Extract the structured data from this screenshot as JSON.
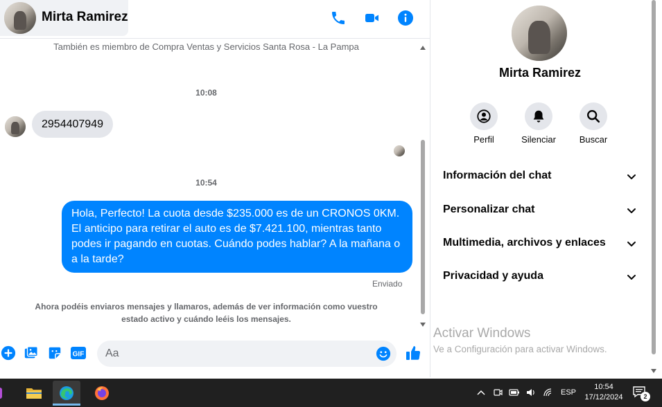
{
  "chat": {
    "contact_name": "Mirta Ramirez",
    "group_notice": "También es miembro de Compra Ventas y Servicios Santa Rosa - La Pampa",
    "time1": "10:08",
    "incoming_message": "2954407949",
    "time2": "10:54",
    "outgoing_message": "Hola, Perfecto! La cuota desde $235.000 es de un CRONOS 0KM. El anticipo para retirar el auto es de $7.421.100, mientras tanto podes ir pagando en cuotas. Cuándo podes hablar? A la mañana o a la tarde?",
    "status": "Enviado",
    "notice": "Ahora podéis enviaros mensajes y llamaros, además de ver información como vuestro estado activo y cuándo leéis los mensajes."
  },
  "composer": {
    "placeholder": "Aa",
    "gif_label": "GIF"
  },
  "panel": {
    "name": "Mirta Ramirez",
    "actions": [
      {
        "label": "Perfil",
        "icon": "profile-icon"
      },
      {
        "label": "Silenciar",
        "icon": "bell-icon"
      },
      {
        "label": "Buscar",
        "icon": "search-icon"
      }
    ],
    "sections": [
      {
        "label": "Información del chat"
      },
      {
        "label": "Personalizar chat"
      },
      {
        "label": "Multimedia, archivos y enlaces"
      },
      {
        "label": "Privacidad y ayuda"
      }
    ]
  },
  "watermark": {
    "title": "Activar Windows",
    "subtitle": "Ve a Configuración para activar Windows."
  },
  "taskbar": {
    "language": "ESP",
    "time": "10:54",
    "date": "17/12/2024",
    "notification_count": "2"
  },
  "colors": {
    "accent": "#0084ff",
    "incoming_bubble": "#e4e6eb",
    "taskbar": "#202020"
  }
}
